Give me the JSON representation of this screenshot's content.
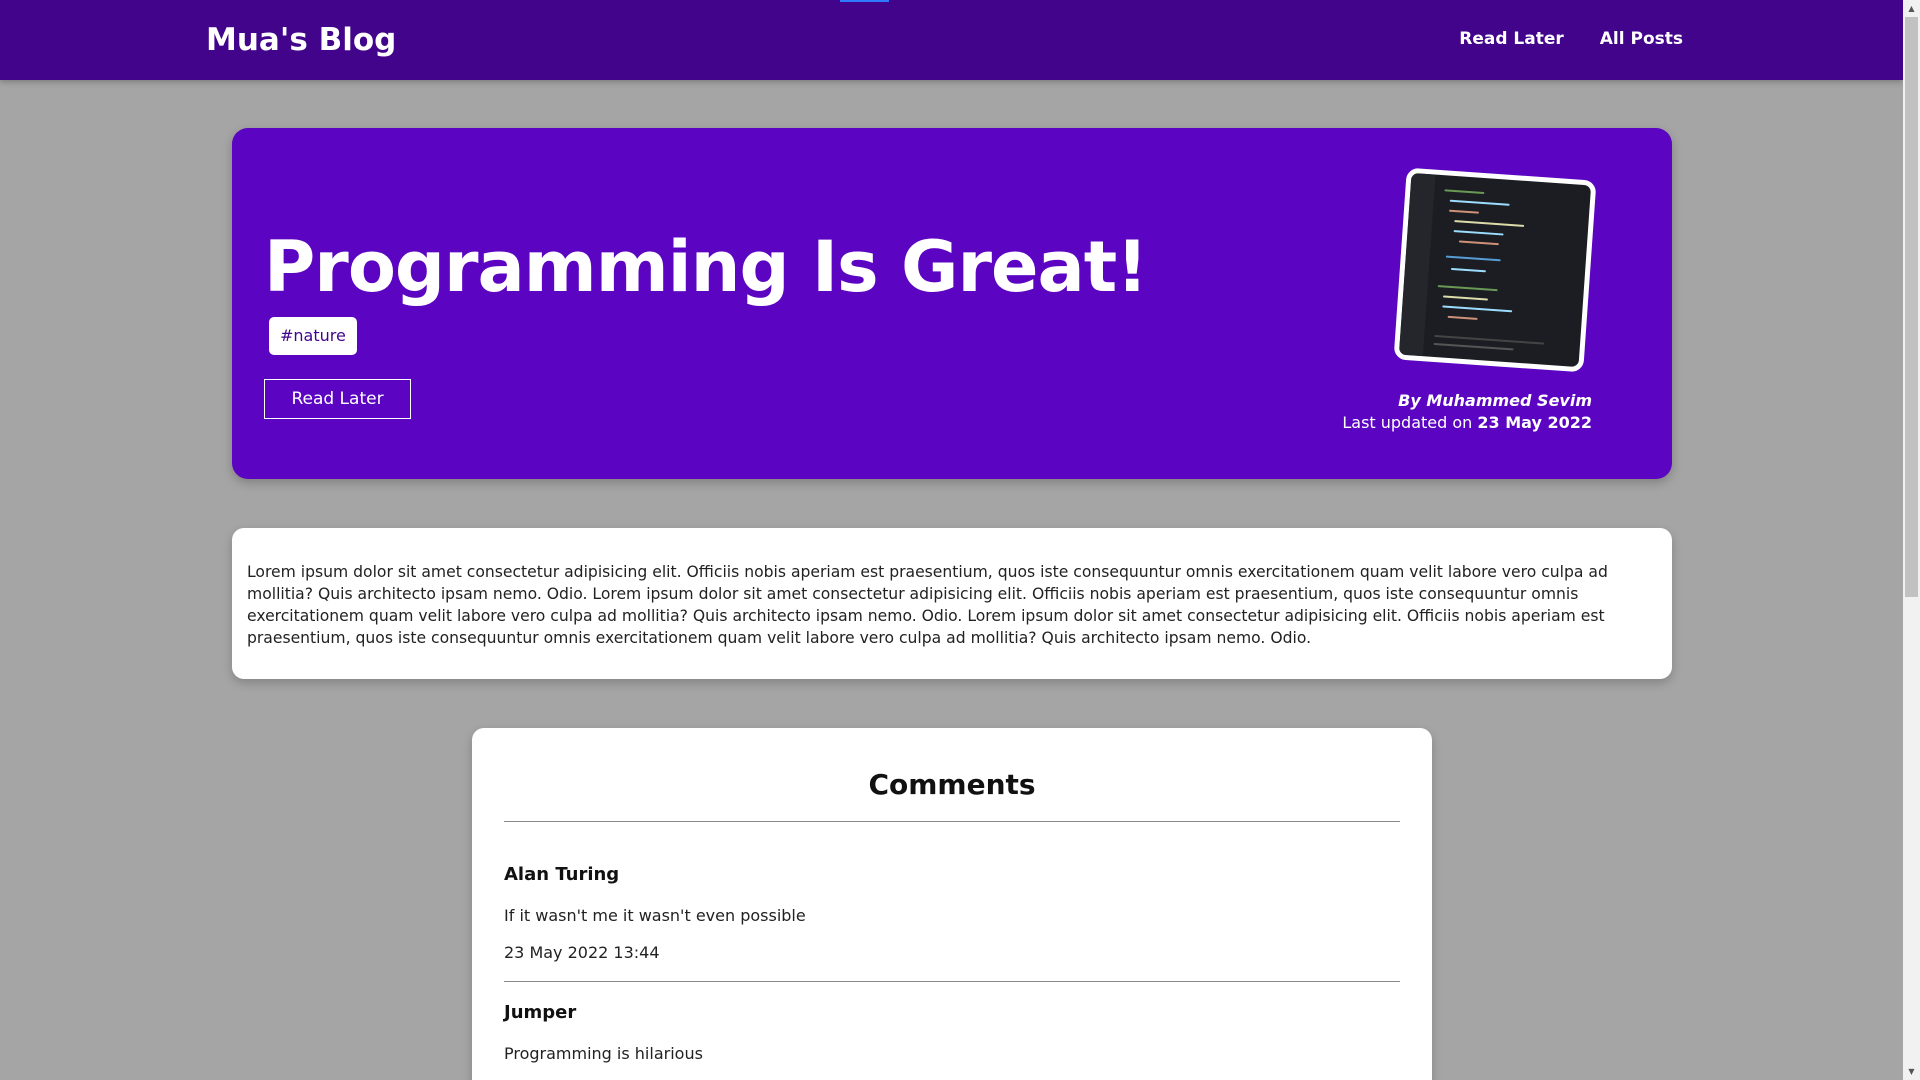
{
  "header": {
    "brand": "Mua's Blog",
    "nav": [
      "Read Later",
      "All Posts"
    ]
  },
  "hero": {
    "title": "Programming Is Great!",
    "tag": "#nature",
    "read_later_label": "Read Later",
    "author": "By Muhammed Sevim",
    "updated_prefix": "Last updated on",
    "updated_date": "23 May 2022",
    "thumbnail": "code-editor-screenshot"
  },
  "post": {
    "body": "Lorem ipsum dolor sit amet consectetur adipisicing elit. Officiis nobis aperiam est praesentium, quos iste consequuntur omnis exercitationem quam velit labore vero culpa ad mollitia? Quis architecto ipsam nemo. Odio. Lorem ipsum dolor sit amet consectetur adipisicing elit. Officiis nobis aperiam est praesentium, quos iste consequuntur omnis exercitationem quam velit labore vero culpa ad mollitia? Quis architecto ipsam nemo. Odio. Lorem ipsum dolor sit amet consectetur adipisicing elit. Officiis nobis aperiam est praesentium, quos iste consequuntur omnis exercitationem quam velit labore vero culpa ad mollitia? Quis architecto ipsam nemo. Odio."
  },
  "comments": {
    "title": "Comments",
    "items": [
      {
        "author": "Alan Turing",
        "text": "If it wasn't me it wasn't even possible",
        "date": "23 May 2022 13:44"
      },
      {
        "author": "Jumper",
        "text": "Programming is hilarious"
      }
    ]
  },
  "colors": {
    "header": "#42048a",
    "hero": "#5b05c2",
    "page_bg": "#a5a5a5"
  }
}
